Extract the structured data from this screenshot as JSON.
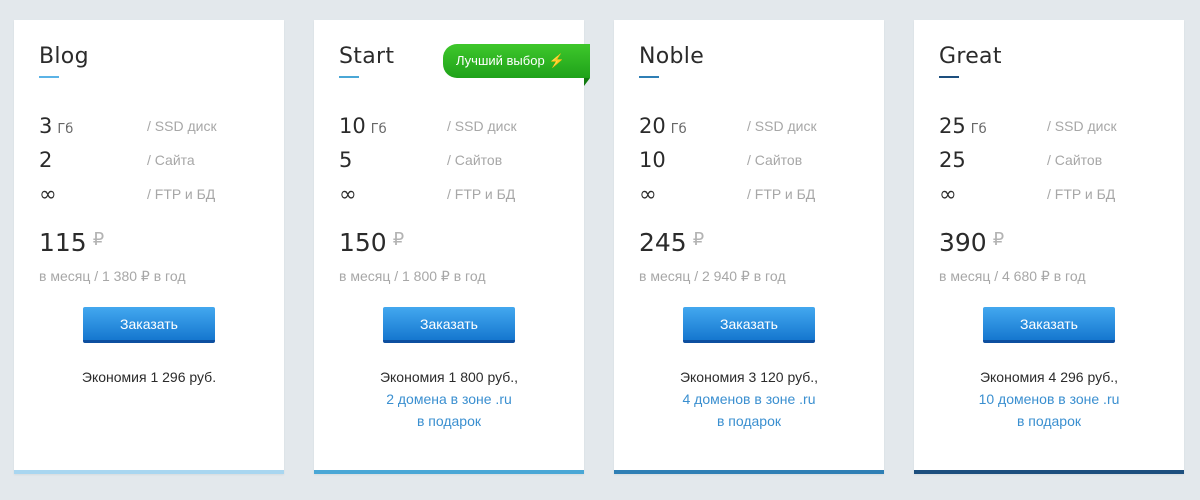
{
  "badge": {
    "label": "Лучший выбор",
    "icon": "lightning-icon"
  },
  "colors": {
    "background": "#e3e8ec",
    "button": "#1f86db",
    "badge": "#2fb324",
    "link": "#3a8fd0"
  },
  "plans": [
    {
      "name": "Blog",
      "accent": "#5bb3e6",
      "bar": "#a9d6f0",
      "disk_value": "3",
      "disk_unit": "Гб",
      "disk_label": "/ SSD диск",
      "sites_value": "2",
      "sites_label": "/ Сайта",
      "ftp_value": "∞",
      "ftp_label": "/ FTP и БД",
      "price": "115",
      "currency": "₽",
      "period": "в месяц / 1 380 ₽ в год",
      "order_label": "Заказать",
      "savings": "Экономия 1 296 руб.",
      "gift_line1": "",
      "gift_line2": ""
    },
    {
      "name": "Start",
      "accent": "#4aa7d6",
      "bar": "#4aa7d6",
      "disk_value": "10",
      "disk_unit": "Гб",
      "disk_label": "/ SSD диск",
      "sites_value": "5",
      "sites_label": "/ Сайтов",
      "ftp_value": "∞",
      "ftp_label": "/ FTP и БД",
      "price": "150",
      "currency": "₽",
      "period": "в месяц / 1 800 ₽ в год",
      "order_label": "Заказать",
      "savings": "Экономия 1 800 руб.,",
      "gift_line1": "2 домена в зоне .ru",
      "gift_line2": "в подарок"
    },
    {
      "name": "Noble",
      "accent": "#2f7fb5",
      "bar": "#2f7fb5",
      "disk_value": "20",
      "disk_unit": "Гб",
      "disk_label": "/ SSD диск",
      "sites_value": "10",
      "sites_label": "/ Сайтов",
      "ftp_value": "∞",
      "ftp_label": "/ FTP и БД",
      "price": "245",
      "currency": "₽",
      "period": "в месяц / 2 940 ₽ в год",
      "order_label": "Заказать",
      "savings": "Экономия 3 120 руб.,",
      "gift_line1": "4 доменов в зоне .ru",
      "gift_line2": "в подарок"
    },
    {
      "name": "Great",
      "accent": "#1d4f7e",
      "bar": "#1d4f7e",
      "disk_value": "25",
      "disk_unit": "Гб",
      "disk_label": "/ SSD диск",
      "sites_value": "25",
      "sites_label": "/ Сайтов",
      "ftp_value": "∞",
      "ftp_label": "/ FTP и БД",
      "price": "390",
      "currency": "₽",
      "period": "в месяц / 4 680 ₽ в год",
      "order_label": "Заказать",
      "savings": "Экономия 4 296 руб.,",
      "gift_line1": "10 доменов в зоне .ru",
      "gift_line2": "в подарок"
    }
  ]
}
